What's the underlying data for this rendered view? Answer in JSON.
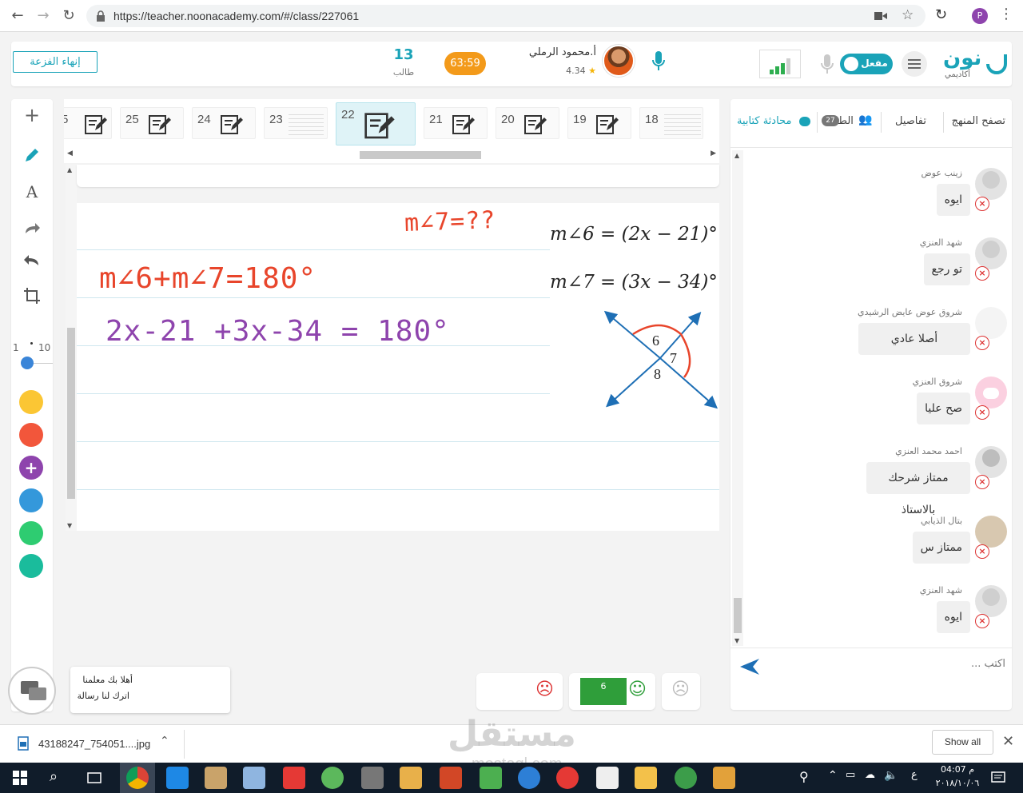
{
  "browser": {
    "url": "https://teacher.noonacademy.com/#/class/227061"
  },
  "header": {
    "end_session_label": "إنهاء الفزعة",
    "student_count": "13",
    "student_label": "طالب",
    "timer": "63:59",
    "teacher_name": "أ.محمود الرملي",
    "rating": "4.34",
    "toggle_label": "مفعل",
    "logo_main": "نون",
    "logo_sub": "أكاديمي"
  },
  "toolbar": {
    "size_min": "1",
    "size_max": "10",
    "colors": [
      "#fbc634",
      "#f2563b",
      "#8e44ad",
      "#3498db",
      "#2ecc71",
      "#1abc9c"
    ]
  },
  "slides": [
    {
      "num": "5"
    },
    {
      "num": "25"
    },
    {
      "num": "24"
    },
    {
      "num": "23"
    },
    {
      "num": "22"
    },
    {
      "num": "21"
    },
    {
      "num": "20"
    },
    {
      "num": "19"
    },
    {
      "num": "18"
    }
  ],
  "board": {
    "angle6": "m∠6 = (2x − 21)°",
    "angle7": "m∠7 = (3x − 34)°",
    "fig_6": "6",
    "fig_7": "7",
    "fig_8": "8",
    "handwriting_1": "m∠7=??",
    "handwriting_2": "m∠6+m∠7=180°",
    "handwriting_3": "2x-21 +3x-34 = 180°"
  },
  "reactions": {
    "happy_count": "6"
  },
  "welcome": {
    "line1": "أهلا بك معلمنا",
    "line2": "اترك لنا رسالة"
  },
  "chat": {
    "tab_curriculum": "تصفح المنهج",
    "tab_details": "تفاصيل",
    "tab_students": "الط",
    "students_badge": "27",
    "tab_chat": "محادثة كتابية",
    "input_placeholder": "اكتب ...",
    "messages": [
      {
        "name": "زينب عوض",
        "text": "ايوه"
      },
      {
        "name": "شهد العنزي",
        "text": "تو رجع"
      },
      {
        "name": "شروق عوض عايض الرشيدي",
        "text": "أصلا عادي"
      },
      {
        "name": "شروق العنزي",
        "text": "صح عليا"
      },
      {
        "name": "احمد محمد العنزي",
        "text": "ممتاز شرحك بالاستاذ"
      },
      {
        "name": "بتال الذيابي",
        "text": "ممتاز س"
      },
      {
        "name": "شهد العنزي",
        "text": "ايوه"
      }
    ]
  },
  "downloads": {
    "file_name": "43188247_754051....jpg",
    "show_all": "Show all"
  },
  "taskbar": {
    "time": "04:07 م",
    "date": "٢٠١٨/١٠/٠٦",
    "lang": "ع"
  },
  "watermark": {
    "text": "مستقل",
    "sub": "mostaql.com"
  }
}
